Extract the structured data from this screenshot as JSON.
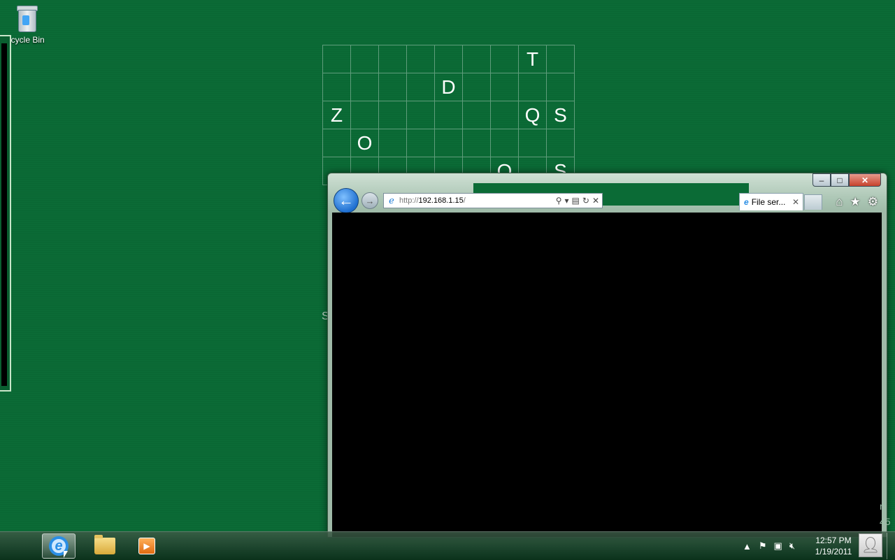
{
  "desktop": {
    "recycle_bin_label": "Recycle Bin"
  },
  "letter_grid": {
    "rows": [
      [
        "",
        "",
        "",
        "",
        "",
        "",
        "",
        "T",
        ""
      ],
      [
        "",
        "",
        "",
        "",
        "D",
        "",
        "",
        "",
        ""
      ],
      [
        "Z",
        "",
        "",
        "",
        "",
        "",
        "",
        "Q",
        "S"
      ],
      [
        "",
        "O",
        "",
        "",
        "",
        "",
        "",
        "",
        ""
      ],
      [
        "",
        "",
        "",
        "",
        "",
        "",
        "O",
        "",
        "S"
      ]
    ],
    "stray_text": "S"
  },
  "browser": {
    "back_icon": "back-arrow-icon",
    "forward_icon": "forward-arrow-icon",
    "address": {
      "scheme": "http://",
      "host": "192.168.1.15",
      "path": "/"
    },
    "tab_title": "File ser...",
    "tab_close": "✕",
    "window_buttons": {
      "minimize": "–",
      "maximize": "□",
      "close": "✕"
    },
    "toolbar_icons": [
      "home-icon",
      "favorites-star-icon",
      "gear-icon"
    ]
  },
  "edge_text": {
    "line1": "n",
    "line2": "45"
  },
  "taskbar": {
    "pinned": [
      {
        "name": "internet-explorer",
        "active": true
      },
      {
        "name": "windows-explorer",
        "active": false
      },
      {
        "name": "windows-media-player",
        "active": false
      }
    ],
    "tray_icons": [
      "show-hidden-icons-arrow",
      "action-center-flag-icon",
      "network-icon",
      "volume-muted-icon"
    ],
    "clock": {
      "time": "12:57 PM",
      "date": "1/19/2011"
    }
  },
  "colors": {
    "desktop": "#0b6b36",
    "ie_blue": "#2b8ee5"
  }
}
